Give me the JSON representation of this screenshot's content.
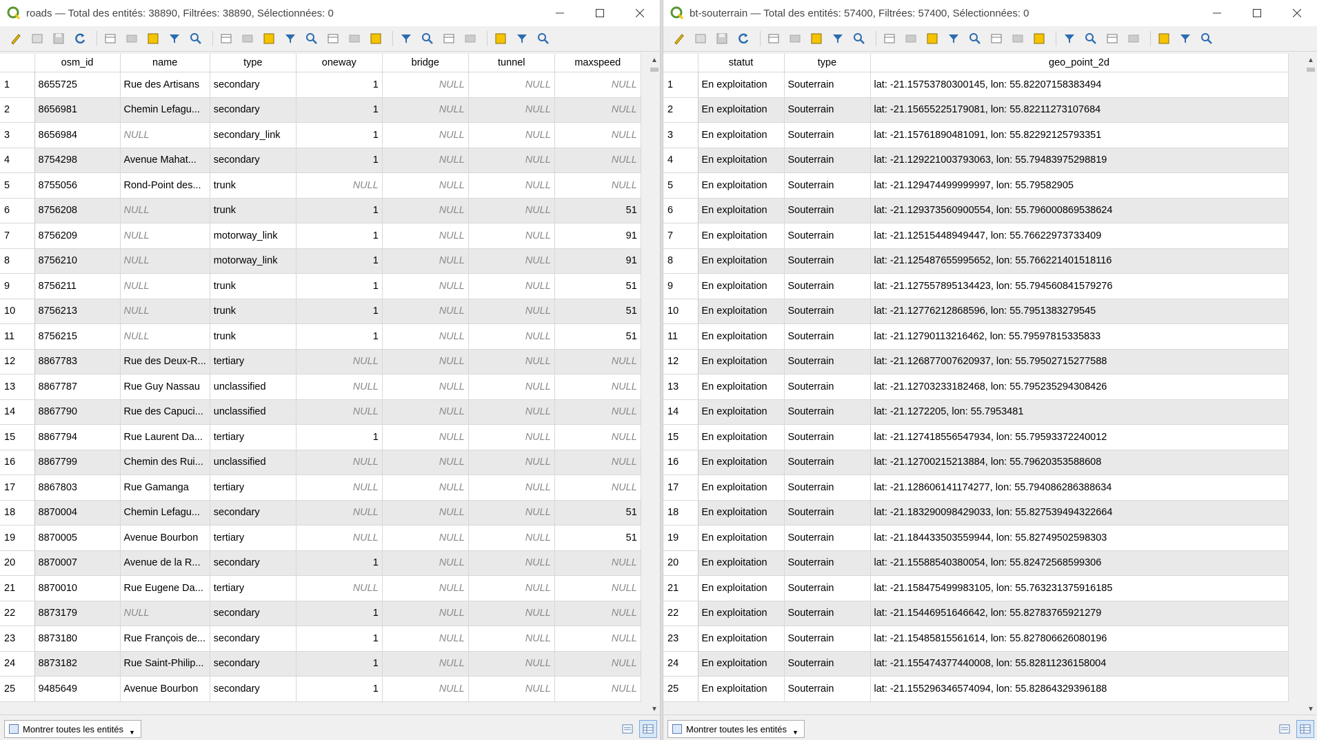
{
  "left": {
    "title": "roads — Total des entités: 38890, Filtrées: 38890, Sélectionnées: 0",
    "columns": [
      "osm_id",
      "name",
      "type",
      "oneway",
      "bridge",
      "tunnel",
      "maxspeed"
    ],
    "rows": [
      [
        "1",
        "8655725",
        "Rue des Artisans",
        "secondary",
        "1",
        "NULL",
        "NULL",
        "NULL"
      ],
      [
        "2",
        "8656981",
        "Chemin Lefagu...",
        "secondary",
        "1",
        "NULL",
        "NULL",
        "NULL"
      ],
      [
        "3",
        "8656984",
        "NULL",
        "secondary_link",
        "1",
        "NULL",
        "NULL",
        "NULL"
      ],
      [
        "4",
        "8754298",
        "Avenue Mahat...",
        "secondary",
        "1",
        "NULL",
        "NULL",
        "NULL"
      ],
      [
        "5",
        "8755056",
        "Rond-Point des...",
        "trunk",
        "NULL",
        "NULL",
        "NULL",
        "NULL"
      ],
      [
        "6",
        "8756208",
        "NULL",
        "trunk",
        "1",
        "NULL",
        "NULL",
        "51"
      ],
      [
        "7",
        "8756209",
        "NULL",
        "motorway_link",
        "1",
        "NULL",
        "NULL",
        "91"
      ],
      [
        "8",
        "8756210",
        "NULL",
        "motorway_link",
        "1",
        "NULL",
        "NULL",
        "91"
      ],
      [
        "9",
        "8756211",
        "NULL",
        "trunk",
        "1",
        "NULL",
        "NULL",
        "51"
      ],
      [
        "10",
        "8756213",
        "NULL",
        "trunk",
        "1",
        "NULL",
        "NULL",
        "51"
      ],
      [
        "11",
        "8756215",
        "NULL",
        "trunk",
        "1",
        "NULL",
        "NULL",
        "51"
      ],
      [
        "12",
        "8867783",
        "Rue des Deux-R...",
        "tertiary",
        "NULL",
        "NULL",
        "NULL",
        "NULL"
      ],
      [
        "13",
        "8867787",
        "Rue Guy Nassau",
        "unclassified",
        "NULL",
        "NULL",
        "NULL",
        "NULL"
      ],
      [
        "14",
        "8867790",
        "Rue des Capuci...",
        "unclassified",
        "NULL",
        "NULL",
        "NULL",
        "NULL"
      ],
      [
        "15",
        "8867794",
        "Rue Laurent Da...",
        "tertiary",
        "1",
        "NULL",
        "NULL",
        "NULL"
      ],
      [
        "16",
        "8867799",
        "Chemin des Rui...",
        "unclassified",
        "NULL",
        "NULL",
        "NULL",
        "NULL"
      ],
      [
        "17",
        "8867803",
        "Rue Gamanga",
        "tertiary",
        "NULL",
        "NULL",
        "NULL",
        "NULL"
      ],
      [
        "18",
        "8870004",
        "Chemin Lefagu...",
        "secondary",
        "NULL",
        "NULL",
        "NULL",
        "51"
      ],
      [
        "19",
        "8870005",
        "Avenue Bourbon",
        "tertiary",
        "NULL",
        "NULL",
        "NULL",
        "51"
      ],
      [
        "20",
        "8870007",
        "Avenue de la R...",
        "secondary",
        "1",
        "NULL",
        "NULL",
        "NULL"
      ],
      [
        "21",
        "8870010",
        "Rue Eugene Da...",
        "tertiary",
        "NULL",
        "NULL",
        "NULL",
        "NULL"
      ],
      [
        "22",
        "8873179",
        "NULL",
        "secondary",
        "1",
        "NULL",
        "NULL",
        "NULL"
      ],
      [
        "23",
        "8873180",
        "Rue François de...",
        "secondary",
        "1",
        "NULL",
        "NULL",
        "NULL"
      ],
      [
        "24",
        "8873182",
        "Rue Saint-Philip...",
        "secondary",
        "1",
        "NULL",
        "NULL",
        "NULL"
      ],
      [
        "25",
        "9485649",
        "Avenue Bourbon",
        "secondary",
        "1",
        "NULL",
        "NULL",
        "NULL"
      ]
    ],
    "show_all_label": "Montrer toutes les entités"
  },
  "right": {
    "title": "bt-souterrain — Total des entités: 57400, Filtrées: 57400, Sélectionnées: 0",
    "columns": [
      "statut",
      "type",
      "geo_point_2d"
    ],
    "rows": [
      [
        "1",
        "En exploitation",
        "Souterrain",
        "lat: -21.15753780300145, lon: 55.82207158383494"
      ],
      [
        "2",
        "En exploitation",
        "Souterrain",
        "lat: -21.15655225179081, lon: 55.82211273107684"
      ],
      [
        "3",
        "En exploitation",
        "Souterrain",
        "lat: -21.15761890481091, lon: 55.82292125793351"
      ],
      [
        "4",
        "En exploitation",
        "Souterrain",
        "lat: -21.129221003793063, lon: 55.79483975298819"
      ],
      [
        "5",
        "En exploitation",
        "Souterrain",
        "lat: -21.129474499999997, lon: 55.79582905"
      ],
      [
        "6",
        "En exploitation",
        "Souterrain",
        "lat: -21.129373560900554, lon: 55.796000869538624"
      ],
      [
        "7",
        "En exploitation",
        "Souterrain",
        "lat: -21.12515448949447, lon: 55.76622973733409"
      ],
      [
        "8",
        "En exploitation",
        "Souterrain",
        "lat: -21.125487655995652, lon: 55.766221401518116"
      ],
      [
        "9",
        "En exploitation",
        "Souterrain",
        "lat: -21.127557895134423, lon: 55.794560841579276"
      ],
      [
        "10",
        "En exploitation",
        "Souterrain",
        "lat: -21.12776212868596, lon: 55.7951383279545"
      ],
      [
        "11",
        "En exploitation",
        "Souterrain",
        "lat: -21.12790113216462, lon: 55.79597815335833"
      ],
      [
        "12",
        "En exploitation",
        "Souterrain",
        "lat: -21.126877007620937, lon: 55.79502715277588"
      ],
      [
        "13",
        "En exploitation",
        "Souterrain",
        "lat: -21.12703233182468, lon: 55.795235294308426"
      ],
      [
        "14",
        "En exploitation",
        "Souterrain",
        "lat: -21.1272205, lon: 55.7953481"
      ],
      [
        "15",
        "En exploitation",
        "Souterrain",
        "lat: -21.127418556547934, lon: 55.79593372240012"
      ],
      [
        "16",
        "En exploitation",
        "Souterrain",
        "lat: -21.12700215213884, lon: 55.79620353588608"
      ],
      [
        "17",
        "En exploitation",
        "Souterrain",
        "lat: -21.128606141174277, lon: 55.794086286388634"
      ],
      [
        "18",
        "En exploitation",
        "Souterrain",
        "lat: -21.183290098429033, lon: 55.827539494322664"
      ],
      [
        "19",
        "En exploitation",
        "Souterrain",
        "lat: -21.184433503559944, lon: 55.82749502598303"
      ],
      [
        "20",
        "En exploitation",
        "Souterrain",
        "lat: -21.15588540380054, lon: 55.82472568599306"
      ],
      [
        "21",
        "En exploitation",
        "Souterrain",
        "lat: -21.158475499983105, lon: 55.763231375916185"
      ],
      [
        "22",
        "En exploitation",
        "Souterrain",
        "lat: -21.15446951646642, lon: 55.82783765921279"
      ],
      [
        "23",
        "En exploitation",
        "Souterrain",
        "lat: -21.15485815561614, lon: 55.827806626080196"
      ],
      [
        "24",
        "En exploitation",
        "Souterrain",
        "lat: -21.155474377440008, lon: 55.82811236158004"
      ],
      [
        "25",
        "En exploitation",
        "Souterrain",
        "lat: -21.155296346574094, lon: 55.82864329396188"
      ]
    ],
    "show_all_label": "Montrer toutes les entités"
  },
  "toolbar_icons": [
    "toggle-editing-icon",
    "multi-edit-icon",
    "save-edits-icon",
    "reload-icon",
    "add-feature-icon",
    "delete-feature-icon",
    "cut-icon",
    "copy-icon",
    "paste-icon",
    "select-expression-icon",
    "select-all-icon",
    "invert-selection-icon",
    "deselect-icon",
    "filter-icon",
    "move-selection-top-icon",
    "pan-to-selection-icon",
    "zoom-to-selection-icon",
    "new-field-icon",
    "delete-field-icon",
    "field-calculator-icon",
    "conditional-formatting-icon",
    "dock-icon",
    "actions-icon",
    "organize-columns-icon"
  ],
  "colors": {
    "qgis_green": "#589632",
    "accent_yellow": "#f5c400",
    "blue": "#2b6cb0"
  }
}
